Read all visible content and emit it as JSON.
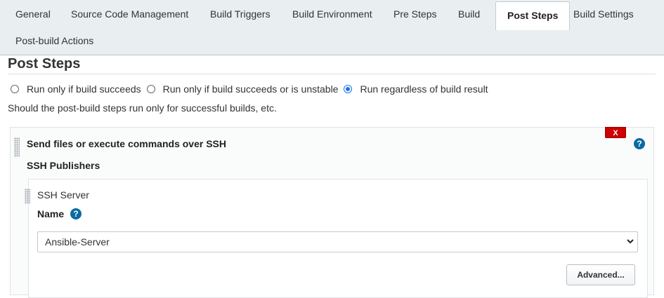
{
  "tabs": [
    {
      "label": "General",
      "active": false
    },
    {
      "label": "Source Code Management",
      "active": false
    },
    {
      "label": "Build Triggers",
      "active": false
    },
    {
      "label": "Build Environment",
      "active": false
    },
    {
      "label": "Pre Steps",
      "active": false
    },
    {
      "label": "Build",
      "active": false
    },
    {
      "label": "Post Steps",
      "active": true
    },
    {
      "label": "Build Settings",
      "active": false
    },
    {
      "label": "Post-build Actions",
      "active": false
    }
  ],
  "section": {
    "title": "Post Steps",
    "radios": [
      {
        "label": "Run only if build succeeds",
        "checked": false
      },
      {
        "label": "Run only if build succeeds or is unstable",
        "checked": false
      },
      {
        "label": "Run regardless of build result",
        "checked": true
      }
    ],
    "description": "Should the post-build steps run only for successful builds, etc."
  },
  "step": {
    "title": "Send files or execute commands over SSH",
    "delete_label": "X",
    "help_label": "?",
    "publishers_label": "SSH Publishers",
    "server": {
      "label": "SSH Server",
      "name_label": "Name",
      "name_help": "?",
      "selected": "Ansible-Server",
      "advanced_label": "Advanced..."
    }
  },
  "icons": {
    "help": "question-mark-circle-icon",
    "dropdown": "chevron-down-icon",
    "drag": "drag-handle-icon"
  },
  "colors": {
    "accent": "#1a73e8",
    "danger": "#cc0000",
    "help": "#0b6aa2",
    "tabbar_bg": "#e9eef1"
  }
}
